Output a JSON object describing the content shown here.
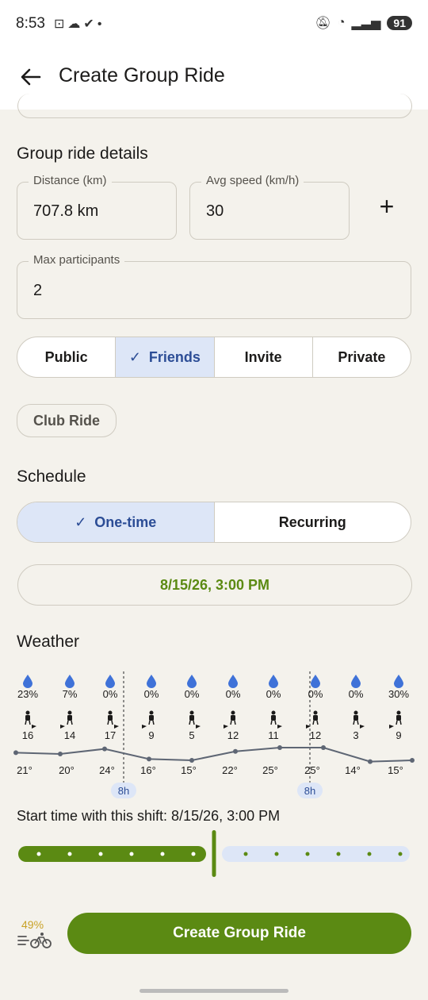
{
  "status_bar": {
    "time": "8:53",
    "battery": "91"
  },
  "app_bar": {
    "title": "Create Group Ride"
  },
  "details": {
    "title": "Group ride details",
    "distance": {
      "label": "Distance (km)",
      "value": "707.8 km"
    },
    "speed": {
      "label": "Avg speed (km/h)",
      "value": "30"
    },
    "participants": {
      "label": "Max participants",
      "value": "2"
    },
    "add_label": "+"
  },
  "visibility": {
    "options": [
      "Public",
      "Friends",
      "Invite",
      "Private"
    ],
    "selected": "Friends"
  },
  "club_chip": "Club Ride",
  "schedule": {
    "title": "Schedule",
    "options": [
      "One-time",
      "Recurring"
    ],
    "selected": "One-time",
    "datetime": "8/15/26, 3:00 PM"
  },
  "weather": {
    "title": "Weather",
    "rain": [
      "23%",
      "7%",
      "0%",
      "0%",
      "0%",
      "0%",
      "0%",
      "0%",
      "0%",
      "30%"
    ],
    "wind": [
      "16",
      "14",
      "17",
      "9",
      "5",
      "12",
      "11",
      "12",
      "3",
      "9"
    ],
    "temps": [
      "21°",
      "20°",
      "24°",
      "16°",
      "15°",
      "22°",
      "25°",
      "25°",
      "14°",
      "15°"
    ],
    "temp_values": [
      21,
      20,
      24,
      16,
      15,
      22,
      25,
      25,
      14,
      15
    ],
    "markers": [
      "8h",
      "8h"
    ]
  },
  "shift": {
    "text": "Start time with this shift: 8/15/26, 3:00 PM",
    "fraction": 0.5
  },
  "bottom": {
    "percent": "49%",
    "button": "Create Group Ride"
  },
  "colors": {
    "accent_green": "#5b8a13",
    "selected_blue": "#dde6f7",
    "rain_blue": "#3f72d8"
  }
}
